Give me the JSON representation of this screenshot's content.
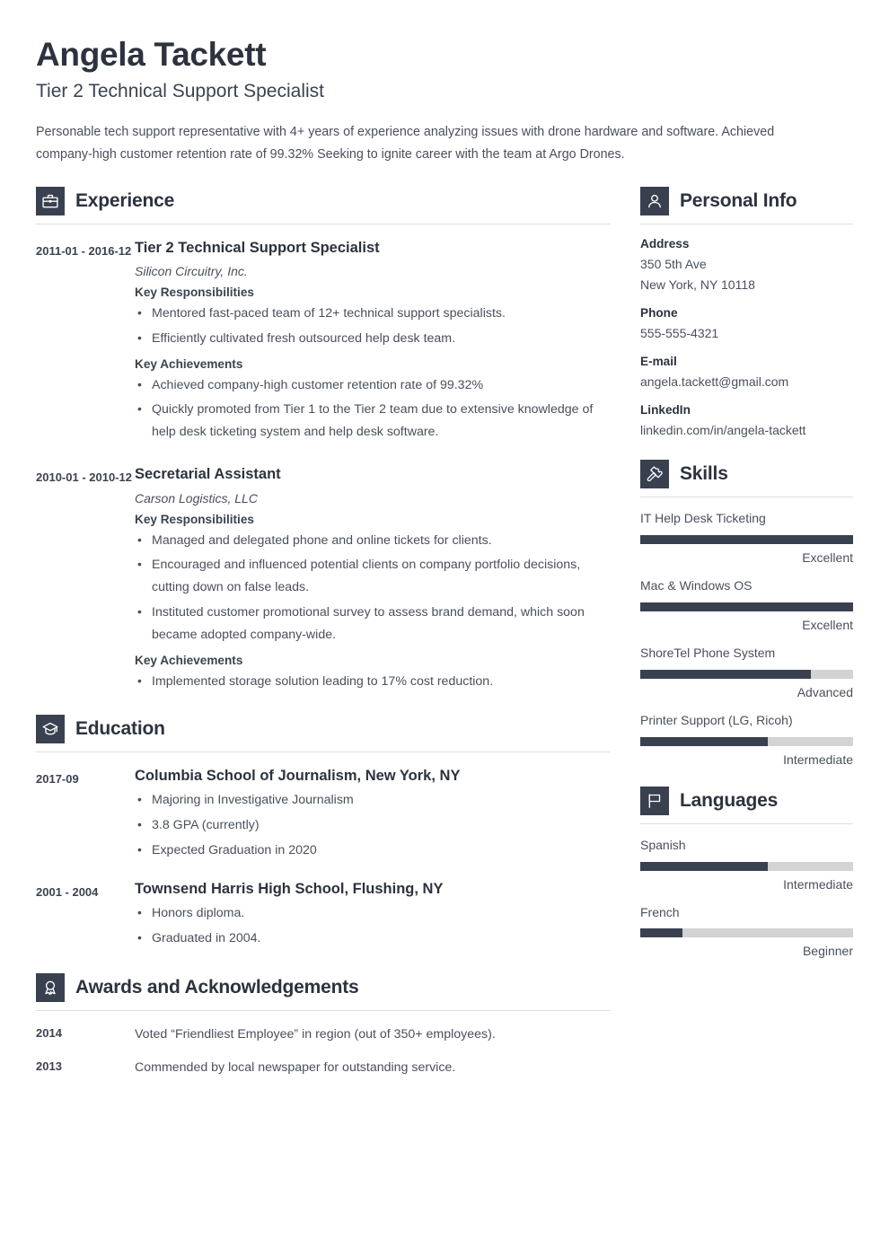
{
  "header": {
    "name": "Angela Tackett",
    "job_title": "Tier 2 Technical Support Specialist",
    "summary": "Personable tech support representative with 4+ years of experience analyzing issues with drone hardware and software. Achieved company-high customer retention rate of 99.32% Seeking to ignite career with the team at Argo Drones."
  },
  "theme": {
    "accent_dark": "#394150",
    "text_dark": "#2d323e",
    "text_body": "#4a4f5c",
    "bar_track": "#d2d3d5",
    "rule": "#dedfe2"
  },
  "sections": {
    "experience": {
      "title": "Experience",
      "icon": "briefcase-icon",
      "entries": [
        {
          "date": "2011-01 - 2016-12",
          "title": "Tier 2 Technical Support Specialist",
          "company": "Silicon Circuitry, Inc.",
          "groups": [
            {
              "label": "Key Responsibilities",
              "items": [
                "Mentored fast-paced team of 12+ technical support specialists.",
                "Efficiently cultivated fresh outsourced help desk team."
              ]
            },
            {
              "label": "Key Achievements",
              "items": [
                "Achieved company-high customer retention rate of 99.32%",
                "Quickly promoted from Tier 1 to the Tier 2 team due to extensive knowledge of help desk ticketing system and help desk software."
              ]
            }
          ]
        },
        {
          "date": "2010-01 - 2010-12",
          "title": "Secretarial Assistant",
          "company": "Carson Logistics, LLC",
          "groups": [
            {
              "label": "Key Responsibilities",
              "items": [
                "Managed and delegated phone and online tickets for clients.",
                "Encouraged and influenced potential clients on company portfolio decisions, cutting down on false leads.",
                "Instituted customer promotional survey to assess brand demand, which soon became adopted company-wide."
              ]
            },
            {
              "label": "Key Achievements",
              "items": [
                "Implemented storage solution leading to 17% cost reduction."
              ]
            }
          ]
        }
      ]
    },
    "education": {
      "title": "Education",
      "icon": "graduation-cap-icon",
      "entries": [
        {
          "date": "2017-09",
          "title": "Columbia School of Journalism, New York, NY",
          "items": [
            "Majoring in Investigative Journalism",
            "3.8 GPA (currently)",
            "Expected Graduation in 2020"
          ]
        },
        {
          "date": "2001 - 2004",
          "title": "Townsend Harris High School, Flushing, NY",
          "items": [
            "Honors diploma.",
            "Graduated in 2004."
          ]
        }
      ]
    },
    "awards": {
      "title": "Awards and Acknowledgements",
      "icon": "award-ribbon-icon",
      "entries": [
        {
          "year": "2014",
          "text": "Voted “Friendliest Employee” in region (out of 350+ employees)."
        },
        {
          "year": "2013",
          "text": "Commended by local newspaper for outstanding service."
        }
      ]
    },
    "personal_info": {
      "title": "Personal Info",
      "icon": "person-icon",
      "fields": [
        {
          "label": "Address",
          "lines": [
            "350 5th Ave",
            "New York, NY 10118"
          ]
        },
        {
          "label": "Phone",
          "lines": [
            "555-555-4321"
          ]
        },
        {
          "label": "E-mail",
          "lines": [
            "angela.tackett@gmail.com"
          ]
        },
        {
          "label": "LinkedIn",
          "lines": [
            "linkedin.com/in/angela-tackett"
          ]
        }
      ]
    },
    "skills": {
      "title": "Skills",
      "icon": "puzzle-piece-icon",
      "items": [
        {
          "name": "IT Help Desk Ticketing",
          "level": "Excellent",
          "percent": 100
        },
        {
          "name": "Mac & Windows OS",
          "level": "Excellent",
          "percent": 100
        },
        {
          "name": "ShoreTel Phone System",
          "level": "Advanced",
          "percent": 80
        },
        {
          "name": "Printer Support (LG, Ricoh)",
          "level": "Intermediate",
          "percent": 60
        }
      ]
    },
    "languages": {
      "title": "Languages",
      "icon": "flag-icon",
      "items": [
        {
          "name": "Spanish",
          "level": "Intermediate",
          "percent": 60
        },
        {
          "name": "French",
          "level": "Beginner",
          "percent": 20
        }
      ]
    }
  }
}
